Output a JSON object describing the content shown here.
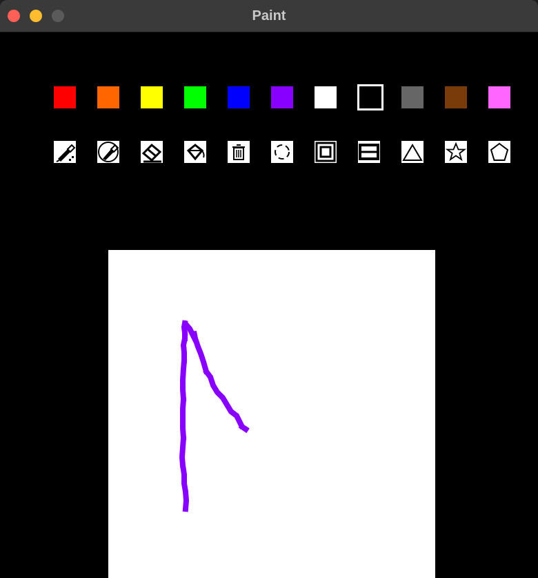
{
  "window": {
    "title": "Paint"
  },
  "palette": [
    {
      "name": "red",
      "color": "#ff0000"
    },
    {
      "name": "orange",
      "color": "#ff6600"
    },
    {
      "name": "yellow",
      "color": "#ffff00"
    },
    {
      "name": "green",
      "color": "#00ff00"
    },
    {
      "name": "blue",
      "color": "#0000ff"
    },
    {
      "name": "purple",
      "color": "#8800ff"
    },
    {
      "name": "white",
      "color": "#ffffff"
    },
    {
      "name": "black",
      "color": "#000000",
      "selected": true
    },
    {
      "name": "gray",
      "color": "#666666"
    },
    {
      "name": "brown",
      "color": "#7a3b0a"
    },
    {
      "name": "pink",
      "color": "#ff66ff"
    }
  ],
  "tools": [
    {
      "name": "pen",
      "icon": "pen-icon"
    },
    {
      "name": "brush",
      "icon": "brush-icon"
    },
    {
      "name": "eraser",
      "icon": "eraser-icon"
    },
    {
      "name": "fill",
      "icon": "paint-bucket-icon"
    },
    {
      "name": "clear",
      "icon": "trash-icon"
    },
    {
      "name": "circle",
      "icon": "circle-icon"
    },
    {
      "name": "square",
      "icon": "square-icon"
    },
    {
      "name": "rectangle",
      "icon": "rectangle-icon"
    },
    {
      "name": "triangle",
      "icon": "triangle-icon"
    },
    {
      "name": "star",
      "icon": "star-icon"
    },
    {
      "name": "pentagon",
      "icon": "pentagon-icon"
    }
  ],
  "drawing": {
    "stroke_color": "#8800ff"
  }
}
